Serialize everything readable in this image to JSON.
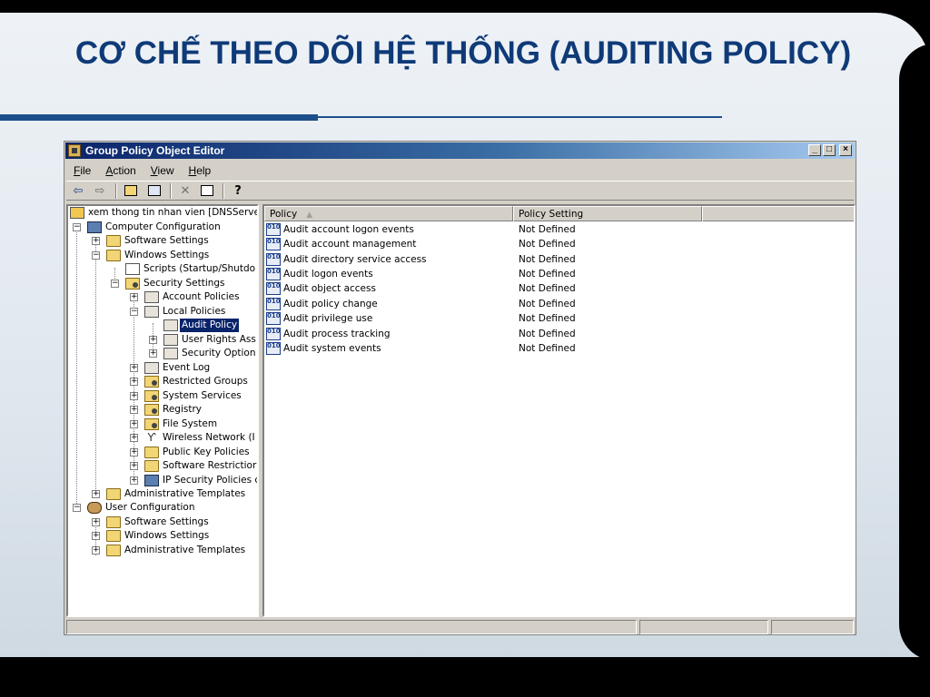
{
  "slide": {
    "title": "CƠ CHẾ THEO DÕI HỆ THỐNG (AUDITING POLICY)",
    "title_color": "#0f3a78"
  },
  "window": {
    "title": "Group Policy Object Editor",
    "controls": [
      "_",
      "□",
      "×"
    ],
    "titlebar_color": "#0a246a"
  },
  "menu": {
    "items": [
      {
        "key": "F",
        "rest": "ile"
      },
      {
        "key": "A",
        "rest": "ction"
      },
      {
        "key": "V",
        "rest": "iew"
      },
      {
        "key": "H",
        "rest": "elp"
      }
    ]
  },
  "toolbar": {
    "icons": [
      "back-arrow-icon",
      "forward-arrow-icon",
      "up-folder-icon",
      "show-hide-tree-icon",
      "delete-icon",
      "export-list-icon",
      "help-icon"
    ],
    "back": "⇦",
    "forward": "⇨",
    "delete": "✕",
    "help": "?"
  },
  "tree": {
    "root": "xem thong tin nhan vien [DNSServe",
    "computer_configuration": "Computer Configuration",
    "software_settings": "Software Settings",
    "windows_settings": "Windows Settings",
    "scripts": "Scripts (Startup/Shutdo",
    "security_settings": "Security Settings",
    "account_policies": "Account Policies",
    "local_policies": "Local Policies",
    "audit_policy": "Audit Policy",
    "user_rights": "User Rights Ass",
    "security_options": "Security Option",
    "event_log": "Event Log",
    "restricted_groups": "Restricted Groups",
    "system_services": "System Services",
    "registry": "Registry",
    "file_system": "File System",
    "wireless_network": "Wireless Network (I",
    "public_key": "Public Key Policies",
    "software_restriction": "Software Restrictior",
    "ip_security": "IP Security Policies c",
    "administrative_templates": "Administrative Templates",
    "user_configuration": "User Configuration",
    "user_software_settings": "Software Settings",
    "user_windows_settings": "Windows Settings",
    "user_administrative_templates": "Administrative Templates",
    "expand": "+",
    "collapse": "−",
    "antenna": "Ƴ"
  },
  "list": {
    "columns": [
      {
        "label": "Policy",
        "sort": "▲"
      },
      {
        "label": "Policy Setting"
      }
    ],
    "icon_glyph": "010 101",
    "rows": [
      {
        "policy": "Audit account logon events",
        "setting": "Not Defined"
      },
      {
        "policy": "Audit account management",
        "setting": "Not Defined"
      },
      {
        "policy": "Audit directory service access",
        "setting": "Not Defined"
      },
      {
        "policy": "Audit logon events",
        "setting": "Not Defined"
      },
      {
        "policy": "Audit object access",
        "setting": "Not Defined"
      },
      {
        "policy": "Audit policy change",
        "setting": "Not Defined"
      },
      {
        "policy": "Audit privilege use",
        "setting": "Not Defined"
      },
      {
        "policy": "Audit process tracking",
        "setting": "Not Defined"
      },
      {
        "policy": "Audit system events",
        "setting": "Not Defined"
      }
    ]
  },
  "scrollbar": {
    "left": "◀",
    "right": "▶"
  }
}
